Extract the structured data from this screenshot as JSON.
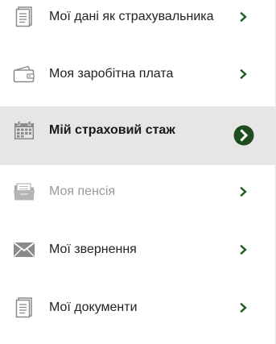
{
  "menu": {
    "items": [
      {
        "label": "Мої дані як страхувальника",
        "icon": "document-icon",
        "state": "normal"
      },
      {
        "label": "Моя заробітна плата",
        "icon": "wallet-icon",
        "state": "normal"
      },
      {
        "label": "Мій страховий стаж",
        "icon": "calendar-icon",
        "state": "active"
      },
      {
        "label": "Моя пенсія",
        "icon": "folder-icon",
        "state": "disabled"
      },
      {
        "label": "Мої звернення",
        "icon": "envelope-icon",
        "state": "normal"
      },
      {
        "label": "Мої документи",
        "icon": "document-icon",
        "state": "normal"
      }
    ]
  },
  "colors": {
    "accent": "#1f4d1f",
    "chevron": "#1f5c1f",
    "active_bg": "#e6e6e6",
    "icon_gray": "#8a8a8a",
    "disabled_text": "#9a9a9a"
  }
}
